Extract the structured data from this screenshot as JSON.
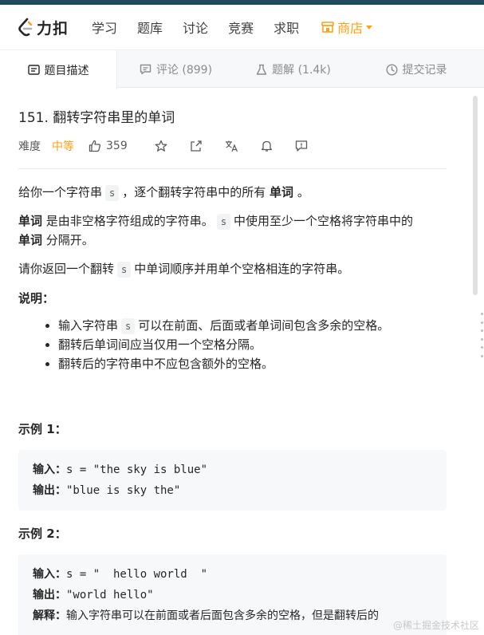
{
  "nav": {
    "logo_text": "力扣",
    "items": [
      "学习",
      "题库",
      "讨论",
      "竞赛",
      "求职"
    ],
    "shop_label": "商店",
    "accent_color": "#ffa116"
  },
  "tabs": [
    {
      "label": "题目描述",
      "icon": "document-icon",
      "active": true
    },
    {
      "label": "评论 (899)",
      "icon": "comment-icon",
      "active": false
    },
    {
      "label": "题解 (1.4k)",
      "icon": "flask-icon",
      "active": false
    },
    {
      "label": "提交记录",
      "icon": "clock-icon",
      "active": false
    }
  ],
  "problem": {
    "title": "151. 翻转字符串里的单词",
    "difficulty_label": "难度",
    "difficulty": "中等",
    "likes": "359"
  },
  "description": {
    "p1": {
      "a": "给你一个字符串",
      "code": "s",
      "b": "，逐个翻转字符串中的所有",
      "bold": "单词",
      "c": "。"
    },
    "p2": {
      "bold1": "单词",
      "a": "是由非空格字符组成的字符串。",
      "code": "s",
      "b": "中使用至少一个空格将字符串中的",
      "bold2": "单词",
      "c": "分隔开。"
    },
    "p3": {
      "a": "请你返回一个翻转",
      "code": "s",
      "b": "中单词顺序并用单个空格相连的字符串。"
    },
    "notes_title": "说明：",
    "notes": [
      {
        "a": "输入字符串",
        "code": "s",
        "b": "可以在前面、后面或者单词间包含多余的空格。"
      },
      {
        "text": "翻转后单词间应当仅用一个空格分隔。"
      },
      {
        "text": "翻转后的字符串中不应包含额外的空格。"
      }
    ]
  },
  "examples": [
    {
      "title": "示例 1：",
      "input_label": "输入：",
      "input": "s = \"the sky is blue\"",
      "output_label": "输出：",
      "output": "\"blue is sky the\""
    },
    {
      "title": "示例 2：",
      "input_label": "输入：",
      "input": "s = \"  hello world  \"",
      "output_label": "输出：",
      "output": "\"world hello\"",
      "explain_label": "解释：",
      "explain": "输入字符串可以在前面或者后面包含多余的空格，但是翻转后的"
    }
  ],
  "watermark": "@稀土掘金技术社区"
}
